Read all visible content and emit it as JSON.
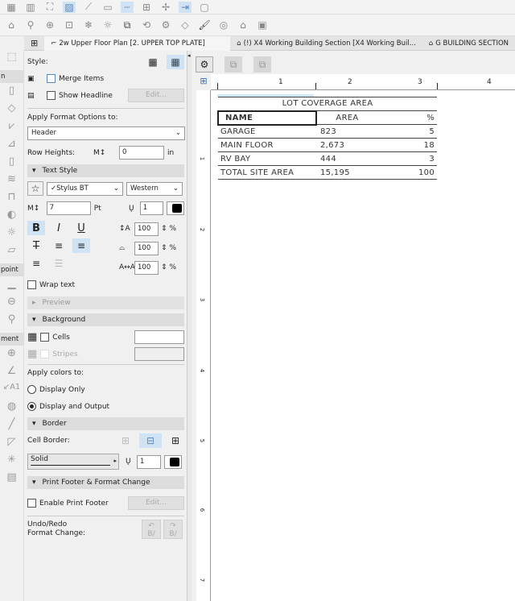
{
  "tabs": [
    {
      "label": "2w Upper Floor Plan [2. UPPER TOP PLATE]"
    },
    {
      "label": "(!) X4 Working Building Section [X4 Working Buil..."
    },
    {
      "label": "G BUILDING SECTION"
    }
  ],
  "left_strip": {
    "labels": [
      "n",
      "point",
      "ment"
    ]
  },
  "panel": {
    "style_label": "Style:",
    "merge_items": "Merge Items",
    "show_headline": "Show Headline",
    "edit": "Edit...",
    "apply_format_label": "Apply Format Options to:",
    "apply_format_value": "Header",
    "row_heights_label": "Row Heights:",
    "row_heights_value": "0",
    "row_heights_unit": "in",
    "text_style": "Text Style",
    "font": "✓Stylus BT",
    "script": "Western",
    "font_size": "7",
    "font_size_unit": "Pt",
    "pen": "1",
    "bold": "B",
    "italic": "I",
    "underline": "U",
    "strike": "T",
    "spacing": [
      "100",
      "100",
      "100"
    ],
    "percent": "%",
    "wrap_text": "Wrap text",
    "preview": "Preview",
    "background": "Background",
    "cells": "Cells",
    "stripes": "Stripes",
    "apply_colors_label": "Apply colors to:",
    "display_only": "Display Only",
    "display_output": "Display and Output",
    "border": "Border",
    "cell_border_label": "Cell Border:",
    "line_type": "Solid",
    "border_pen": "1",
    "print_footer": "Print Footer & Format Change",
    "enable_print_footer": "Enable Print Footer",
    "undo_redo": "Undo/Redo",
    "format_change": "Format Change:",
    "undo_glyph": "B/",
    "redo_glyph": "B/"
  },
  "ruler": {
    "h": [
      "1",
      "2",
      "3",
      "4"
    ],
    "v": [
      "1",
      "2",
      "3",
      "4",
      "5",
      "6",
      "7"
    ]
  },
  "schedule": {
    "title": "LOT COVERAGE AREA",
    "headers": [
      "NAME",
      "AREA",
      "%"
    ],
    "rows": [
      [
        "GARAGE",
        "823",
        "5"
      ],
      [
        "MAIN FLOOR",
        "2,673",
        "18"
      ],
      [
        "RV BAY",
        "444",
        "3"
      ],
      [
        "TOTAL SITE AREA",
        "15,195",
        "100"
      ]
    ]
  },
  "colors": {
    "accent": "#cfe3f5"
  }
}
